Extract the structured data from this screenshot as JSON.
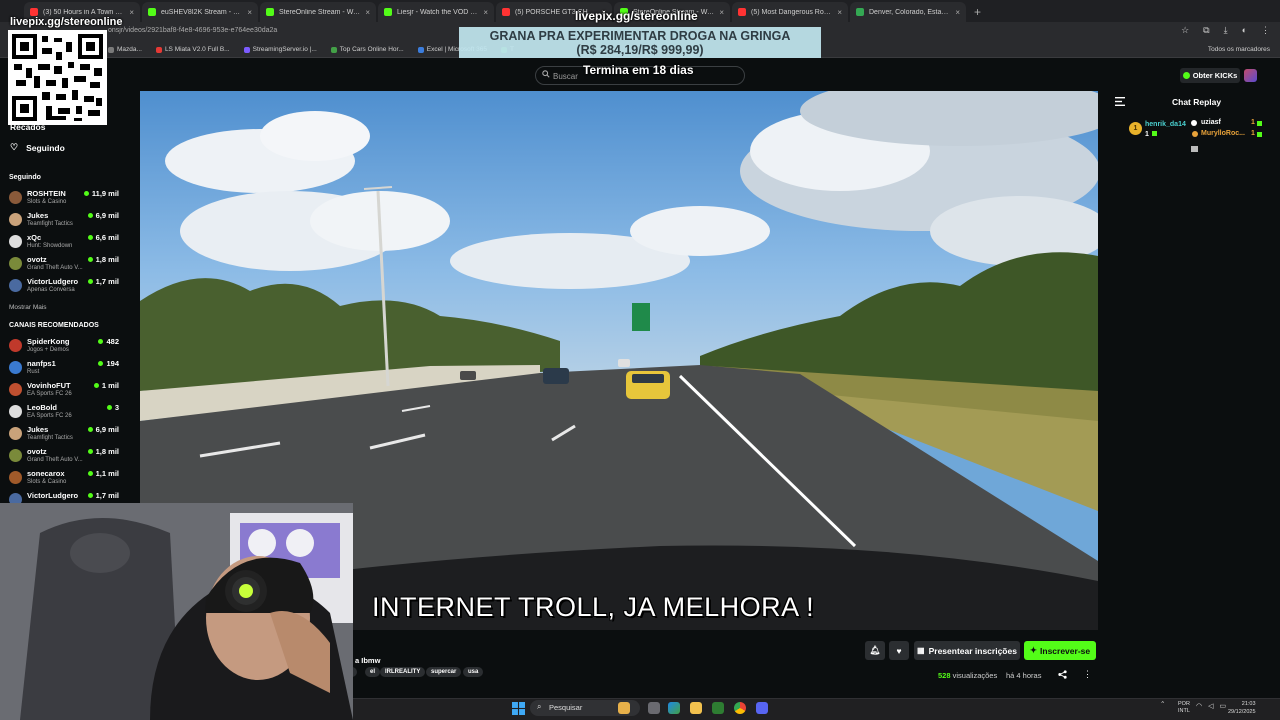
{
  "browser": {
    "tabs": [
      {
        "title": "(3) 50 Hours in A Town Built Ar",
        "color": "#ff3333"
      },
      {
        "title": "euSHEV8I2K Stream - Watch Liv",
        "color": "#53fc18"
      },
      {
        "title": "StereOnline Stream - Watch Liv",
        "color": "#53fc18"
      },
      {
        "title": "Liesjr - Watch the VOD on Kick",
        "color": "#53fc18"
      },
      {
        "title": "(5) PORSCHE GT3 CHASES DOW",
        "color": "#ff3333"
      },
      {
        "title": "StereOnline Stream - Watch Liv",
        "color": "#53fc18"
      },
      {
        "title": "(5) Most Dangerous Road? Sco",
        "color": "#ff3333"
      },
      {
        "title": "Denver, Colorado, Estados Unid",
        "color": "#34a853"
      }
    ],
    "url": "onsjr/videos/2921baf8-f4e8-4696-953e-e764ee30da2a",
    "bookmarks": [
      {
        "label": "Mazda...",
        "color": "#7a7a7a"
      },
      {
        "label": "LS Miata V2.0 Full B...",
        "color": "#e53935"
      },
      {
        "label": "StreamingServer.io |...",
        "color": "#7c5cff"
      },
      {
        "label": "Top Cars Online Hor...",
        "color": "#43a047"
      },
      {
        "label": "Excel | Microsoft 365",
        "color": "#3b7ddd"
      },
      {
        "label": "T",
        "color": "#43a047"
      }
    ],
    "all_bookmarks": "Todos os marcadores"
  },
  "header": {
    "search_placeholder": "Buscar",
    "kick_button": "Obter KICKs"
  },
  "overlay": {
    "top": "livepix.gg/stereonline",
    "line1": "GRANA PRA EXPERIMENTAR DROGA NA GRINGA",
    "line2": "(R$ 284,19/R$ 999,99)",
    "sub": "Termina em 18 dias",
    "qr_label": "livepix.gg/stereonline"
  },
  "sidebar": {
    "nav_partial": "Recados",
    "following_nav": "Seguindo",
    "following_header": "Seguindo",
    "following": [
      {
        "name": "ROSHTEIN",
        "game": "Slots & Casino",
        "viewers": "11,9 mil",
        "color": "#8a5a3a"
      },
      {
        "name": "Jukes",
        "game": "Teamfight Tactics",
        "viewers": "6,9 mil",
        "color": "#c9a27a"
      },
      {
        "name": "xQc",
        "game": "Hunt: Showdown",
        "viewers": "6,6 mil",
        "color": "#dddddd"
      },
      {
        "name": "ovotz",
        "game": "Grand Theft Auto V...",
        "viewers": "1,8 mil",
        "color": "#7a8a3a"
      },
      {
        "name": "VictorLudgero",
        "game": "Apenas Conversa",
        "viewers": "1,7 mil",
        "color": "#4a6aa0"
      }
    ],
    "show_more": "Mostrar Mais",
    "recommended_header": "CANAIS RECOMENDADOS",
    "recommended": [
      {
        "name": "SpiderKong",
        "game": "Jogos + Demos",
        "viewers": "482",
        "color": "#c0392b"
      },
      {
        "name": "nanfps1",
        "game": "Rust",
        "viewers": "194",
        "color": "#3a7ad0"
      },
      {
        "name": "VovinhoFUT",
        "game": "EA Sports FC 26",
        "viewers": "1 mil",
        "color": "#c05030"
      },
      {
        "name": "LeoBold",
        "game": "EA Sports FC 26",
        "viewers": "3",
        "color": "#dddddd"
      },
      {
        "name": "Jukes",
        "game": "Teamfight Tactics",
        "viewers": "6,9 mil",
        "color": "#c9a27a"
      },
      {
        "name": "ovotz",
        "game": "Grand Theft Auto V...",
        "viewers": "1,8 mil",
        "color": "#7a8a3a"
      },
      {
        "name": "sonecarox",
        "game": "Slots & Casino",
        "viewers": "1,1 mil",
        "color": "#a05a2a"
      },
      {
        "name": "VictorLudgero",
        "game": "",
        "viewers": "1,7 mil",
        "color": "#4a6aa0"
      }
    ]
  },
  "video": {
    "subtitle": "INTERNET TROLL, JA MELHORA !",
    "title_partial": "a Ibmw",
    "tags": [
      "g",
      "el",
      "IRLREALITY",
      "supercar",
      "usa"
    ],
    "views_count": "528",
    "views_label": "visualizações",
    "ago": "há 4 horas",
    "gift_button": "Presentear inscrições",
    "subscribe_button": "Inscrever-se"
  },
  "chat": {
    "title": "Chat Replay",
    "badge": "1",
    "user1": "henrik_da14",
    "user2": "uziasf",
    "user3": "MurylloRoc...",
    "count1": "1",
    "count2": "1",
    "count3": "1",
    "count4": "1"
  },
  "taskbar": {
    "search": "Pesquisar",
    "lang_top": "POR",
    "lang_bottom": "INTL",
    "time": "21:03",
    "date": "29/12/2025"
  }
}
